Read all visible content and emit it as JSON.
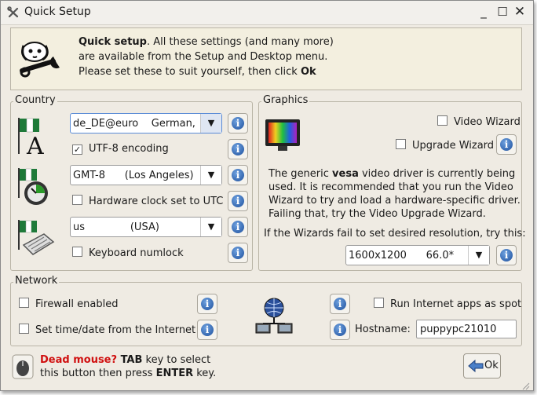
{
  "window": {
    "title": "Quick Setup",
    "icons": [
      "tools-icon",
      "minimize-icon",
      "maximize-icon",
      "close-icon"
    ]
  },
  "banner": {
    "bold": "Quick setup",
    "line1_rest": ". All these settings (and many more)",
    "line2": "are available from the Setup and Desktop menu.",
    "line3_pre": "Please set these to suit yourself, then click ",
    "line3_bold": "Ok"
  },
  "country": {
    "title": "Country",
    "locale_value": "de_DE@euro    German, Germany",
    "utf8_label": "UTF-8 encoding",
    "utf8_checked": true,
    "timezone_value": "GMT-8      (Los Angeles)",
    "hwclock_label": "Hardware clock set to UTC",
    "hwclock_checked": false,
    "keyboard_value": "us              (USA)",
    "numlock_label": "Keyboard numlock",
    "numlock_checked": false
  },
  "graphics": {
    "title": "Graphics",
    "video_wizard_label": "Video Wizard",
    "video_wizard_checked": false,
    "upgrade_wizard_label": "Upgrade Wizard",
    "upgrade_wizard_checked": false,
    "desc_pre": "The generic ",
    "desc_bold": "vesa",
    "desc_rest": " video driver is currently being",
    "desc2": "used. It is recommended that you run the Video",
    "desc3": "Wizard to try and load a hardware-specific driver.",
    "desc4": "Failing that, try the Video Upgrade Wizard.",
    "fallback_label": "If the Wizards fail to set desired resolution, try this:",
    "resolution_value": "1600x1200      66.0*"
  },
  "network": {
    "title": "Network",
    "firewall_label": "Firewall enabled",
    "firewall_checked": false,
    "timedate_label": "Set time/date from the Internet",
    "timedate_checked": false,
    "spot_label": "Run Internet apps as spot",
    "spot_checked": false,
    "hostname_label": "Hostname:",
    "hostname_value": "puppypc21010"
  },
  "footer": {
    "dead_mouse": "Dead mouse?",
    "tab": " TAB",
    "line1_rest": " key to select",
    "line2_pre": "this button then press ",
    "enter": "ENTER",
    "line2_post": " key.",
    "ok_label": "Ok"
  },
  "colors": {
    "accent_red": "#d01010",
    "info_blue": "#1d4f9c",
    "focus_blue": "#5a8bd6"
  }
}
